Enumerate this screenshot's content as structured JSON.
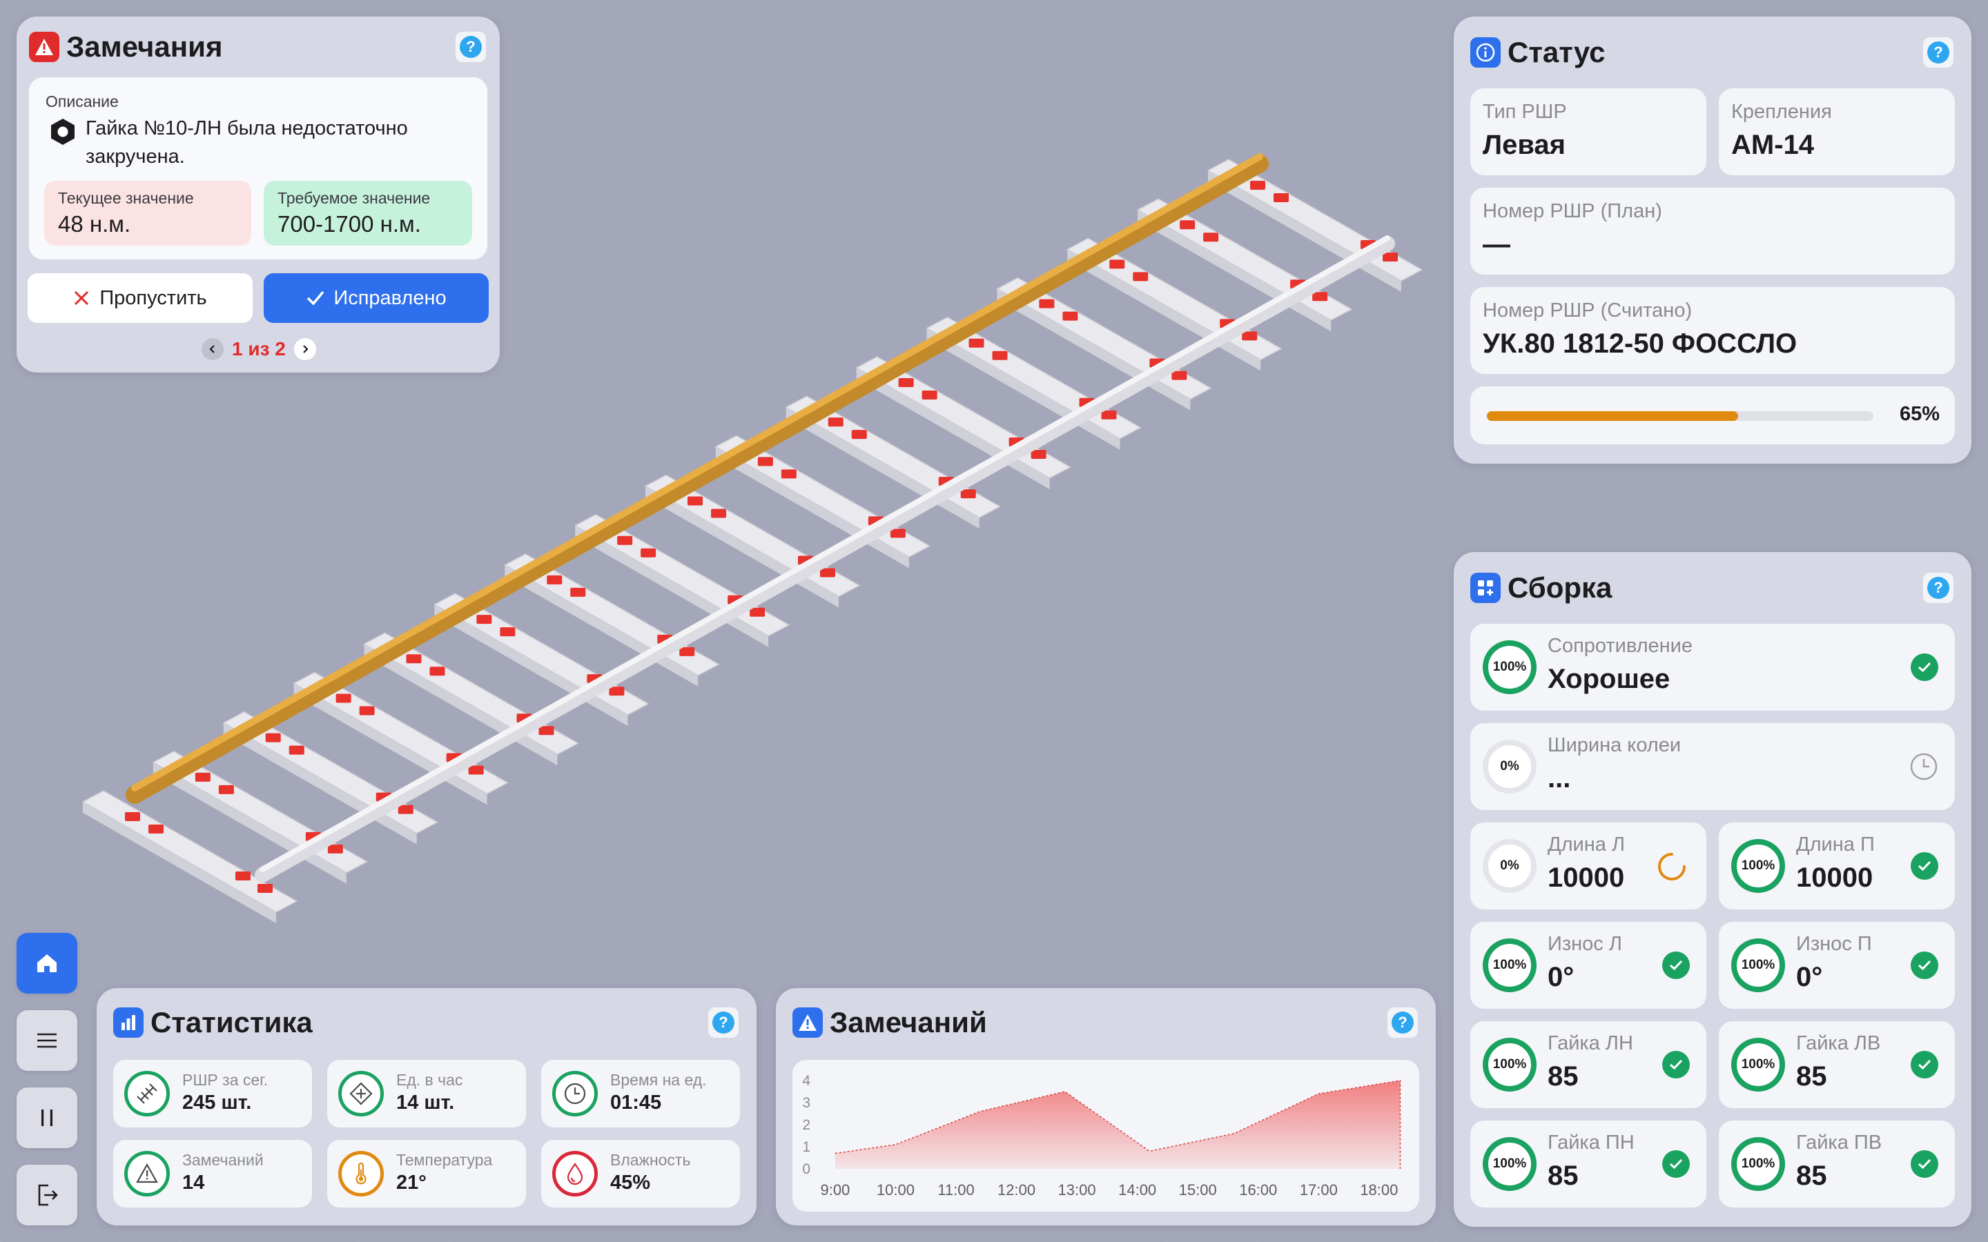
{
  "remarks_panel": {
    "title": "Замечания",
    "description_label": "Описание",
    "description_text": "Гайка №10-ЛН была недостаточно закручена.",
    "current": {
      "label": "Текущее значение",
      "value": "48 н.м."
    },
    "required": {
      "label": "Требуемое значение",
      "value": "700-1700 н.м."
    },
    "skip_label": "Пропустить",
    "fixed_label": "Исправлено",
    "pager": "1 из 2",
    "help": "?"
  },
  "status_panel": {
    "title": "Статус",
    "type": {
      "label": "Тип РШР",
      "value": "Левая"
    },
    "fasteners": {
      "label": "Крепления",
      "value": "АМ-14"
    },
    "plan_number": {
      "label": "Номер РШР (План)",
      "value": "—"
    },
    "scanned_number": {
      "label": "Номер РШР (Считано)",
      "value": "УК.80 1812-50 ФОССЛО"
    },
    "progress_value": 0.65,
    "progress_label": "65%",
    "help": "?"
  },
  "assembly_panel": {
    "title": "Сборка",
    "help": "?",
    "resistance": {
      "label": "Сопротивление",
      "value": "Хорошее",
      "pct": "100%"
    },
    "gauge": {
      "label": "Ширина колеи",
      "value": "...",
      "pct": "0%"
    },
    "length_l": {
      "label": "Длина Л",
      "value": "10000",
      "pct": "0%"
    },
    "length_r": {
      "label": "Длина П",
      "value": "10000",
      "pct": "100%"
    },
    "wear_l": {
      "label": "Износ Л",
      "value": "0°",
      "pct": "100%"
    },
    "wear_r": {
      "label": "Износ П",
      "value": "0°",
      "pct": "100%"
    },
    "nut_ln": {
      "label": "Гайка ЛН",
      "value": "85",
      "pct": "100%"
    },
    "nut_lv": {
      "label": "Гайка ЛВ",
      "value": "85",
      "pct": "100%"
    },
    "nut_pn": {
      "label": "Гайка ПН",
      "value": "85",
      "pct": "100%"
    },
    "nut_pv": {
      "label": "Гайка ПВ",
      "value": "85",
      "pct": "100%"
    }
  },
  "statistics_panel": {
    "title": "Статистика",
    "help": "?",
    "items": [
      {
        "label": "РШР за сег.",
        "value": "245 шт.",
        "icon": "rails-icon",
        "color": "#1aa260"
      },
      {
        "label": "Ед. в час",
        "value": "14 шт.",
        "icon": "crosshair-icon",
        "color": "#1aa260"
      },
      {
        "label": "Время на ед.",
        "value": "01:45",
        "icon": "clock-icon",
        "color": "#1aa260"
      },
      {
        "label": "Замечаний",
        "value": "14",
        "icon": "warning-icon",
        "color": "#1aa260"
      },
      {
        "label": "Температура",
        "value": "21°",
        "icon": "thermometer-icon",
        "color": "#e08a10"
      },
      {
        "label": "Влажность",
        "value": "45%",
        "icon": "drop-icon",
        "color": "#d8283a"
      }
    ]
  },
  "remarks_chart_panel": {
    "title": "Замечаний",
    "help": "?"
  },
  "chart_data": {
    "type": "area",
    "categories": [
      "9:00",
      "10:00",
      "11:00",
      "12:00",
      "13:00",
      "14:00",
      "15:00",
      "16:00",
      "17:00",
      "18:00"
    ],
    "series": [
      {
        "values": [
          0.7,
          1.1,
          2.6,
          3.5,
          0.8,
          1.6,
          3.4,
          4.0
        ]
      }
    ],
    "x_positions": [
      9.0,
      10.0,
      11.4,
      12.8,
      14.2,
      15.6,
      17.0,
      18.35
    ],
    "yticks": [
      "0",
      "1",
      "2",
      "3",
      "4"
    ],
    "ylim": [
      0,
      4
    ],
    "xlim": [
      8.75,
      18.55
    ],
    "color": "#f06a6a"
  },
  "nav": {
    "home_icon": "home-icon",
    "menu_icon": "menu-icon",
    "pause_icon": "pause-icon",
    "logout_icon": "logout-icon"
  },
  "colors": {
    "accent": "#2d6fec",
    "success": "#1aa260",
    "danger": "#e02b2b",
    "warning": "#e08a10"
  }
}
